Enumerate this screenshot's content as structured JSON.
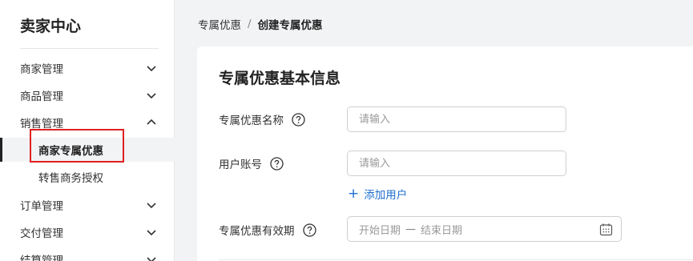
{
  "sidebar": {
    "title": "卖家中心",
    "items": [
      {
        "label": "商家管理",
        "expanded": false
      },
      {
        "label": "商品管理",
        "expanded": false
      },
      {
        "label": "销售管理",
        "expanded": true
      },
      {
        "label": "订单管理",
        "expanded": false
      },
      {
        "label": "交付管理",
        "expanded": false
      },
      {
        "label": "结算管理",
        "expanded": false
      }
    ],
    "subitems": [
      {
        "label": "商家专属优惠",
        "active": true
      },
      {
        "label": "转售商务授权",
        "active": false
      }
    ]
  },
  "breadcrumb": {
    "parent": "专属优惠",
    "separator": "/",
    "current": "创建专属优惠"
  },
  "form": {
    "title": "专属优惠基本信息",
    "name_label": "专属优惠名称",
    "name_placeholder": "请输入",
    "account_label": "用户账号",
    "account_placeholder": "请输入",
    "add_user_label": "添加用户",
    "validity_label": "专属优惠有效期",
    "start_date_placeholder": "开始日期",
    "range_separator": "—",
    "end_date_placeholder": "结束日期"
  },
  "colors": {
    "accent": "#1f6fd1",
    "highlight": "#e02020"
  }
}
